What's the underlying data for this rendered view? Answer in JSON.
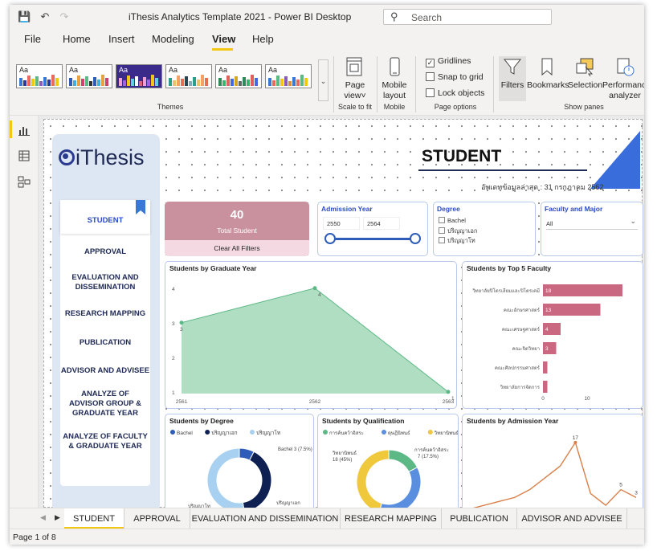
{
  "window": {
    "title": "iThesis Analytics Template 2021 - Power BI Desktop",
    "search_placeholder": "Search"
  },
  "menu": [
    "File",
    "Home",
    "Insert",
    "Modeling",
    "View",
    "Help"
  ],
  "menu_active": "View",
  "ribbon": {
    "themes_label": "Themes",
    "theme_sample_text": "Aa",
    "page_view": {
      "label1": "Page",
      "label2": "view"
    },
    "scale_label": "Scale to fit",
    "mobile": {
      "label1": "Mobile",
      "label2": "layout",
      "group": "Mobile"
    },
    "options": {
      "gridlines": "Gridlines",
      "snap": "Snap to grid",
      "lock": "Lock objects",
      "gridlines_checked": true,
      "group": "Page options"
    },
    "panes": {
      "filters": "Filters",
      "bookmarks": "Bookmarks",
      "selection": "Selection",
      "performance1": "Performance",
      "performance2": "analyzer",
      "group": "Show panes"
    }
  },
  "report": {
    "logo_text": "iThesis",
    "nav": [
      "STUDENT",
      "APPROVAL",
      "EVALUATION AND DISSEMINATION",
      "RESEARCH MAPPING",
      "PUBLICATION",
      "ADVISOR AND ADVISEE",
      "ANALYZE OF ADVISOR GROUP & GRADUATE YEAR",
      "ANALYZE OF FACULTY & GRADUATE YEAR"
    ],
    "header_title": "STUDENT",
    "update_text": "อัพเดทข้อมูลล่าสุด : 31 กรกฎาคม 2562",
    "total": {
      "value": "40",
      "label": "Total Student"
    },
    "clear_filters": "Clear All Filters",
    "admission_slicer": {
      "title": "Admission Year",
      "from": "2550",
      "to": "2564"
    },
    "degree_slicer": {
      "title": "Degree",
      "options": [
        "Bachel",
        "ปริญญาเอก",
        "ปริญญาโท"
      ]
    },
    "faculty_slicer": {
      "title": "Faculty and Major",
      "value": "All"
    }
  },
  "chart_data": [
    {
      "type": "area",
      "title": "Students by Graduate Year",
      "x": [
        2561,
        2562,
        2563
      ],
      "values": [
        3,
        4,
        1
      ],
      "ylim": [
        1,
        4
      ],
      "yticks": [
        1,
        2,
        3,
        4
      ],
      "xtick_labels": [
        "2561",
        "2562",
        "2563"
      ],
      "color": "#8fd0a8"
    },
    {
      "type": "bar",
      "title": "Students by Top 5 Faculty",
      "categories": [
        "วิทยาลัยปิโตรเลียมและปิโตรเคมี",
        "คณะอักษรศาสตร์",
        "คณะเศรษฐศาสตร์",
        "คณะจิตวิทยา",
        "คณะศิลปกรรมศาสตร์",
        "วิทยาลัยการจัดการ"
      ],
      "values": [
        18,
        13,
        4,
        3,
        1,
        1
      ],
      "xticks": [
        "0",
        "10"
      ],
      "xlim": [
        0,
        20
      ],
      "color": "#c96880"
    },
    {
      "type": "pie",
      "title": "Students by Degree",
      "series": [
        {
          "name": "Bachel",
          "values": [
            3
          ],
          "color": "#2e5cb8"
        },
        {
          "name": "ปริญญาเอก",
          "values": [
            16
          ],
          "color": "#0e1f52"
        },
        {
          "name": "ปริญญาโท",
          "values": [
            21
          ],
          "color": "#a8d0f0"
        }
      ],
      "labels": [
        "Bachel 3 (7.5%)",
        "ปริญญาเอก",
        "ปริญญาโท"
      ]
    },
    {
      "type": "pie",
      "title": "Students by Qualification",
      "series": [
        {
          "name": "การค้นคว้าอิสระ",
          "values": [
            7
          ],
          "color": "#5cb885"
        },
        {
          "name": "ดุษฎีนิพนธ์",
          "values": [
            15
          ],
          "color": "#5a8fe0"
        },
        {
          "name": "วิทยานิพนธ์",
          "values": [
            18
          ],
          "color": "#f0c83c"
        }
      ],
      "labels": [
        "วิทยานิพนธ์ 18 (45%)",
        "การค้นคว้าอิสระ 7 (17.5%)"
      ]
    },
    {
      "type": "line",
      "title": "Students by Admission Year",
      "values": [
        0,
        1,
        2,
        3,
        5,
        8,
        11,
        17,
        4,
        1,
        5,
        3
      ],
      "data_labels": [
        "17",
        "5",
        "3"
      ],
      "color": "#d9804a"
    }
  ],
  "page_tabs": [
    "STUDENT",
    "APPROVAL",
    "EVALUATION AND DISSEMINATION",
    "RESEARCH MAPPING",
    "PUBLICATION",
    "ADVISOR AND ADVISEE"
  ],
  "status": "Page 1 of 8"
}
